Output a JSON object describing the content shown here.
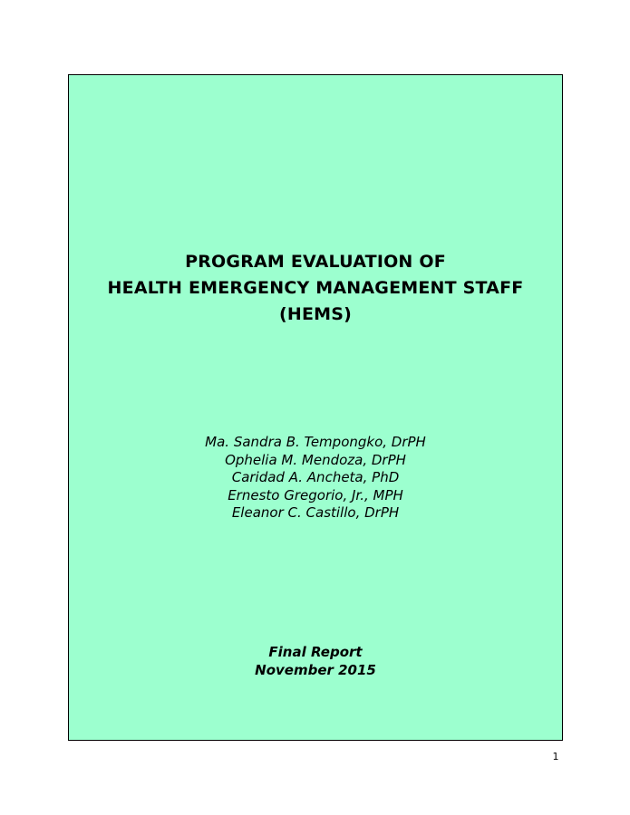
{
  "cover": {
    "title_lines": [
      "PROGRAM EVALUATION OF",
      "HEALTH EMERGENCY MANAGEMENT STAFF",
      "(HEMS)"
    ],
    "authors": [
      "Ma. Sandra B. Tempongko, DrPH",
      "Ophelia M. Mendoza, DrPH",
      "Caridad A. Ancheta, PhD",
      "Ernesto Gregorio, Jr., MPH",
      "Eleanor C. Castillo, DrPH"
    ],
    "report_type": "Final Report",
    "report_date": "November 2015",
    "background_color": "#9cffcf"
  },
  "footer": {
    "page_number": "1"
  }
}
